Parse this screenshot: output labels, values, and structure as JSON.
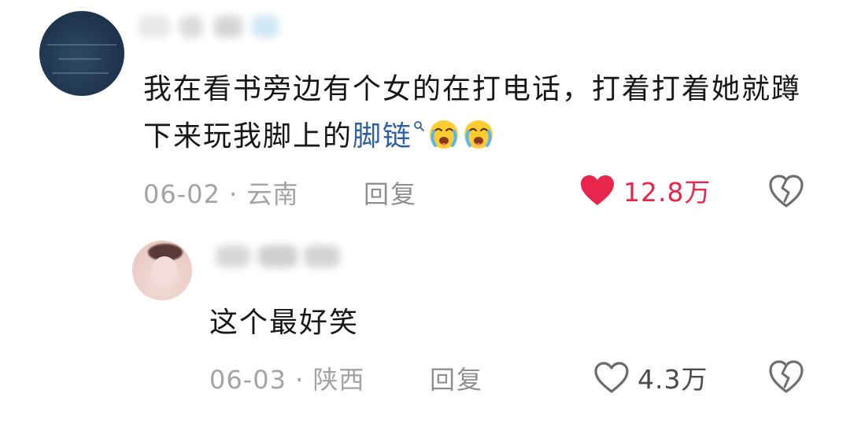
{
  "main_comment": {
    "text_before_link": "我在看书旁边有个女的在打电话，打着打着她就蹲下来玩我脚上的",
    "search_link": "脚链",
    "date": "06-02",
    "separator": "·",
    "location": "云南",
    "reply_label": "回复",
    "like_count": "12.8万",
    "liked": true,
    "emojis": [
      "crying-face-icon",
      "crying-face-icon"
    ]
  },
  "reply_comment": {
    "text": "这个最好笑",
    "date": "06-03",
    "separator": "·",
    "location": "陕西",
    "reply_label": "回复",
    "like_count": "4.3万",
    "liked": false
  },
  "colors": {
    "liked_red": "#e8254a",
    "link_blue": "#2f5fa3",
    "meta_gray": "#a3a3a3",
    "text_dark": "#161616"
  }
}
